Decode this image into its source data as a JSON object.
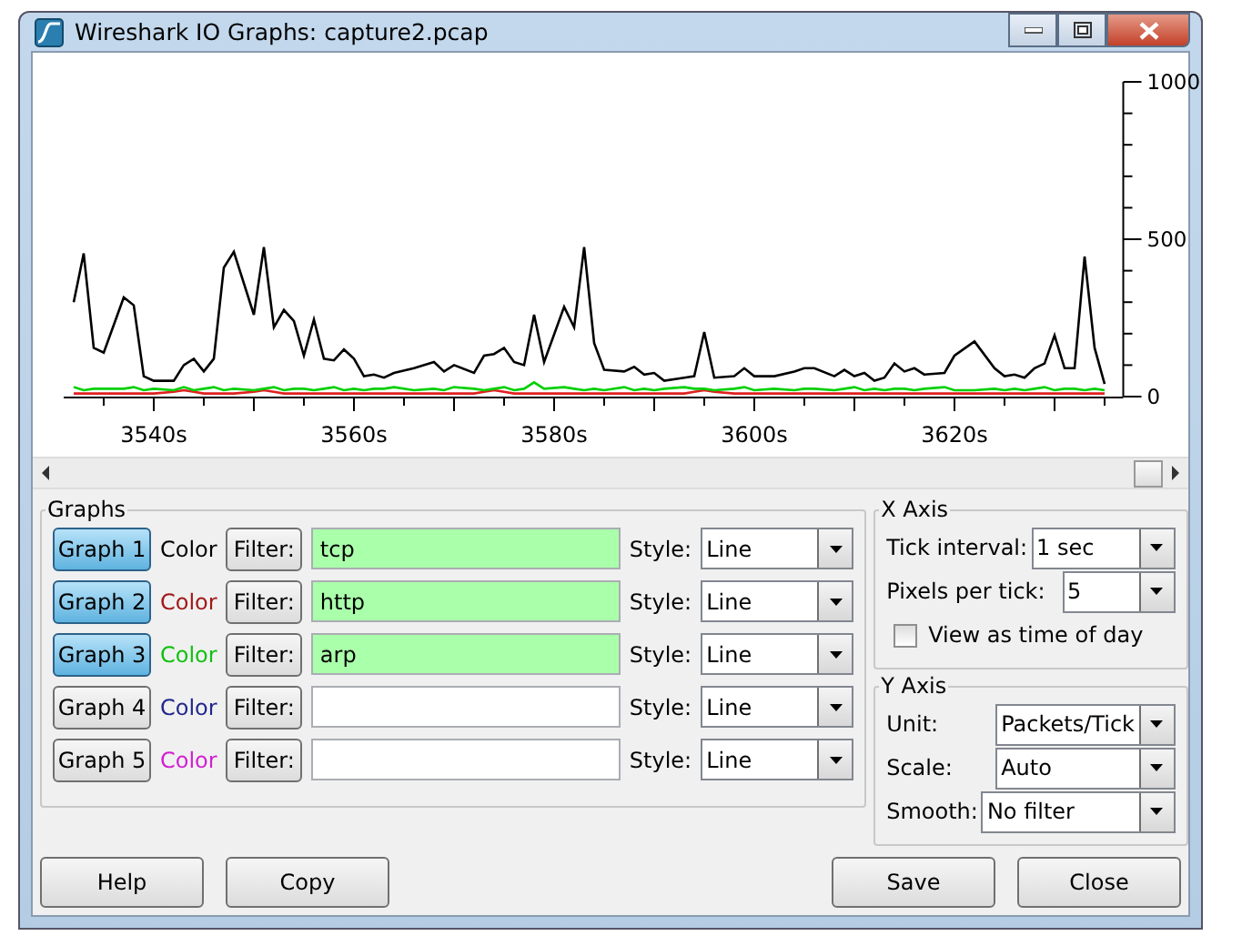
{
  "window": {
    "title": "Wireshark IO Graphs: capture2.pcap"
  },
  "chart": {
    "chart_data": {
      "type": "line",
      "x": [
        3532,
        3533,
        3534,
        3535,
        3537,
        3538,
        3539,
        3540,
        3542,
        3543,
        3544,
        3545,
        3546,
        3547,
        3548,
        3550,
        3551,
        3552,
        3553,
        3554,
        3555,
        3556,
        3557,
        3558,
        3559,
        3560,
        3561,
        3562,
        3563,
        3564,
        3566,
        3568,
        3569,
        3570,
        3572,
        3573,
        3574,
        3575,
        3576,
        3577,
        3578,
        3579,
        3581,
        3582,
        3583,
        3584,
        3585,
        3587,
        3588,
        3589,
        3590,
        3591,
        3593,
        3594,
        3595,
        3596,
        3598,
        3599,
        3600,
        3602,
        3604,
        3605,
        3606,
        3608,
        3609,
        3610,
        3611,
        3612,
        3613,
        3614,
        3615,
        3616,
        3617,
        3619,
        3620,
        3622,
        3624,
        3625,
        3626,
        3627,
        3628,
        3629,
        3630,
        3631,
        3632,
        3633,
        3634,
        3635
      ],
      "series": [
        {
          "color": "#000000",
          "values": [
            300,
            455,
            155,
            140,
            315,
            290,
            65,
            50,
            50,
            100,
            120,
            80,
            120,
            410,
            460,
            260,
            475,
            220,
            275,
            240,
            130,
            245,
            120,
            115,
            150,
            120,
            65,
            70,
            60,
            75,
            90,
            110,
            80,
            100,
            75,
            130,
            135,
            155,
            110,
            100,
            260,
            110,
            285,
            220,
            475,
            170,
            85,
            80,
            95,
            70,
            75,
            50,
            60,
            65,
            205,
            60,
            65,
            90,
            65,
            65,
            80,
            90,
            90,
            65,
            85,
            65,
            75,
            50,
            60,
            105,
            80,
            90,
            70,
            75,
            130,
            175,
            90,
            65,
            70,
            60,
            90,
            105,
            195,
            90,
            90,
            445,
            155,
            40
          ]
        },
        {
          "color": "#e02020",
          "values": [
            10,
            10,
            10,
            10,
            10,
            10,
            10,
            10,
            15,
            20,
            15,
            10,
            10,
            10,
            10,
            15,
            20,
            15,
            10,
            10,
            10,
            10,
            10,
            10,
            10,
            10,
            10,
            10,
            10,
            10,
            10,
            10,
            10,
            10,
            10,
            15,
            20,
            15,
            10,
            10,
            10,
            10,
            10,
            10,
            10,
            10,
            10,
            10,
            10,
            10,
            10,
            10,
            10,
            15,
            20,
            15,
            10,
            10,
            10,
            10,
            10,
            10,
            10,
            10,
            10,
            10,
            10,
            10,
            10,
            10,
            10,
            10,
            10,
            10,
            10,
            10,
            10,
            10,
            10,
            10,
            10,
            10,
            10,
            10,
            10,
            10,
            10,
            10
          ]
        },
        {
          "color": "#00d000",
          "values": [
            30,
            20,
            25,
            25,
            25,
            30,
            20,
            25,
            20,
            30,
            20,
            25,
            30,
            20,
            25,
            20,
            25,
            30,
            20,
            25,
            25,
            20,
            25,
            30,
            20,
            25,
            20,
            25,
            25,
            30,
            20,
            25,
            20,
            30,
            25,
            20,
            25,
            30,
            20,
            25,
            45,
            25,
            30,
            25,
            20,
            25,
            20,
            30,
            20,
            25,
            20,
            25,
            30,
            25,
            25,
            20,
            25,
            30,
            20,
            25,
            20,
            25,
            25,
            20,
            25,
            30,
            20,
            25,
            20,
            25,
            25,
            20,
            25,
            30,
            20,
            20,
            25,
            20,
            25,
            20,
            25,
            30,
            20,
            25,
            25,
            20,
            25,
            20
          ]
        }
      ],
      "xlim": [
        3531,
        3636.5
      ],
      "ylim": [
        0,
        1000
      ],
      "xticks": [
        {
          "value": 3540,
          "label": "3540s"
        },
        {
          "value": 3560,
          "label": "3560s"
        },
        {
          "value": 3580,
          "label": "3580s"
        },
        {
          "value": 3600,
          "label": "3600s"
        },
        {
          "value": 3620,
          "label": "3620s"
        }
      ],
      "yticks": [
        0,
        500,
        1000
      ]
    }
  },
  "graphs": {
    "title": "Graphs",
    "rows": [
      {
        "button": "Graph 1",
        "selected": true,
        "color_label": "Color",
        "color": "#000000",
        "filter_button": "Filter:",
        "filter": "tcp",
        "style_label": "Style:",
        "style": "Line"
      },
      {
        "button": "Graph 2",
        "selected": true,
        "color_label": "Color",
        "color": "#a01818",
        "filter_button": "Filter:",
        "filter": "http",
        "style_label": "Style:",
        "style": "Line"
      },
      {
        "button": "Graph 3",
        "selected": true,
        "color_label": "Color",
        "color": "#10c010",
        "filter_button": "Filter:",
        "filter": "arp",
        "style_label": "Style:",
        "style": "Line"
      },
      {
        "button": "Graph 4",
        "selected": false,
        "color_label": "Color",
        "color": "#20288c",
        "filter_button": "Filter:",
        "style_label": "Style:",
        "style": "Line"
      },
      {
        "button": "Graph 5",
        "selected": false,
        "color_label": "Color",
        "color": "#d020d0",
        "filter_button": "Filter:",
        "style_label": "Style:",
        "style": "Line"
      }
    ]
  },
  "x_axis": {
    "title": "X Axis",
    "tick_interval_label": "Tick interval:",
    "tick_interval": "1 sec",
    "pixels_label": "Pixels per tick:",
    "pixels": "5",
    "time_of_day": {
      "label": "View as time of day",
      "checked": false
    }
  },
  "y_axis": {
    "title": "Y Axis",
    "unit_label": "Unit:",
    "unit": "Packets/Tick",
    "scale_label": "Scale:",
    "scale": "Auto",
    "smooth_label": "Smooth:",
    "smooth": "No filter"
  },
  "buttons_left": [
    "Help",
    "Copy"
  ],
  "buttons_right": [
    "Save",
    "Close"
  ]
}
